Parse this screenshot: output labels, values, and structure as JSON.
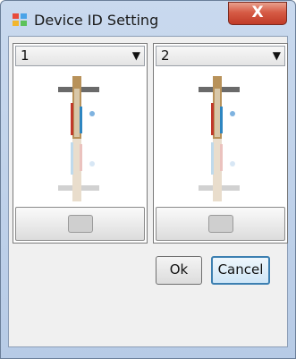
{
  "window": {
    "title": "Device ID Setting",
    "close_label": "X"
  },
  "panels": [
    {
      "selected_id": "1",
      "dropdown_icon": "chevron-down-icon",
      "preview_icon": "camera-preview-icon",
      "button_icon": "camera-icon"
    },
    {
      "selected_id": "2",
      "dropdown_icon": "chevron-down-icon",
      "preview_icon": "camera-preview-icon",
      "button_icon": "camera-icon"
    }
  ],
  "buttons": {
    "ok": "Ok",
    "cancel": "Cancel"
  },
  "colors": {
    "accent": "#3c7fb1",
    "close": "#c13b28"
  }
}
